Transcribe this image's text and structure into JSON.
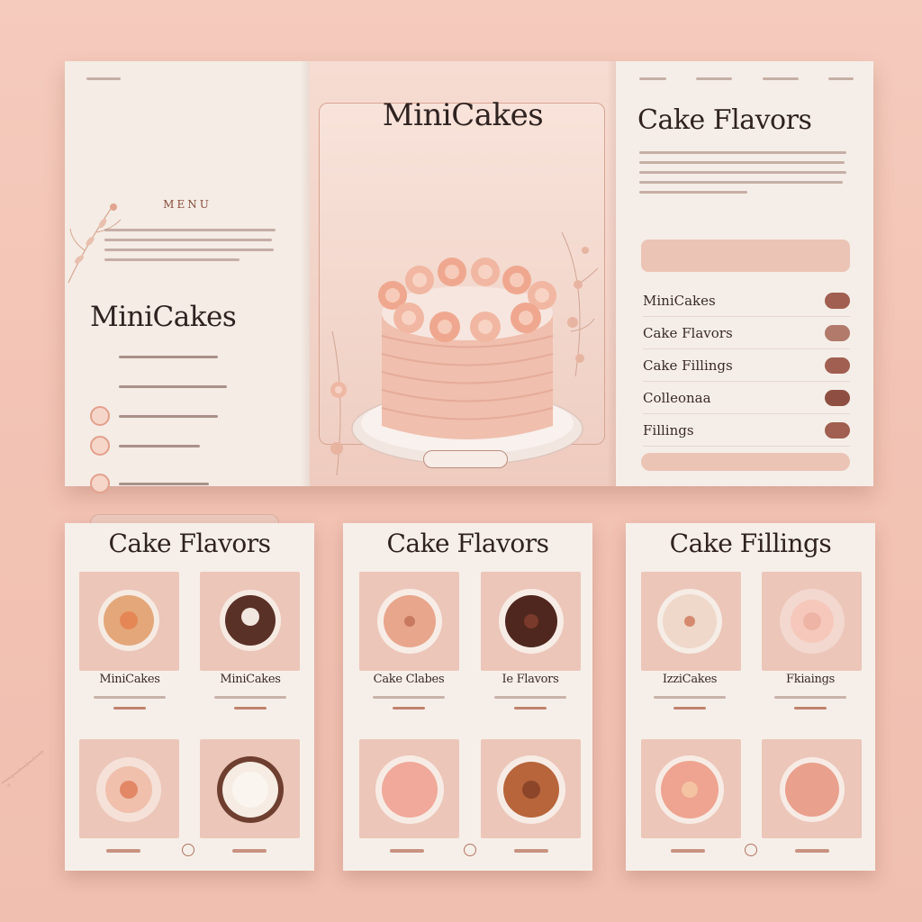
{
  "colors": {
    "background": "#f2c4b5",
    "paper": "#f5eee8",
    "accent": "#a05f50",
    "tile": "#ecc6b9",
    "text": "#2f2220"
  },
  "brochure": {
    "left_panel": {
      "menu_label": "MENU",
      "brand": "MiniCakes"
    },
    "middle_panel": {
      "title": "MiniCakes"
    },
    "right_panel": {
      "title": "Cake Flavors",
      "items": [
        {
          "label": "MiniCakes"
        },
        {
          "label": "Cake Flavors"
        },
        {
          "label": "Cake Fillings"
        },
        {
          "label": "Colleonaa"
        },
        {
          "label": "Fillings"
        }
      ]
    }
  },
  "cards": [
    {
      "title": "Cake Flavors",
      "items": [
        {
          "name": "MiniCakes",
          "icon": "cake-top-orange-icon"
        },
        {
          "name": "MiniCakes",
          "icon": "chocolate-cake-icon"
        },
        {
          "name": "",
          "icon": "flower-cake-icon"
        },
        {
          "name": "",
          "icon": "cream-tart-icon"
        }
      ]
    },
    {
      "title": "Cake Flavors",
      "items": [
        {
          "name": "Cake Clabes",
          "icon": "sprinkle-cake-icon"
        },
        {
          "name": "Ie Flavors",
          "icon": "chocolate-cake-icon"
        },
        {
          "name": "",
          "icon": "pink-cake-icon"
        },
        {
          "name": "",
          "icon": "caramel-cake-icon"
        }
      ]
    },
    {
      "title": "Cake Fillings",
      "items": [
        {
          "name": "IzziCakes",
          "icon": "confetti-cake-icon"
        },
        {
          "name": "Fkiaings",
          "icon": "rose-cream-icon"
        },
        {
          "name": "",
          "icon": "pink-frosted-cake-icon"
        },
        {
          "name": "",
          "icon": "peach-cake-icon"
        }
      ]
    }
  ]
}
